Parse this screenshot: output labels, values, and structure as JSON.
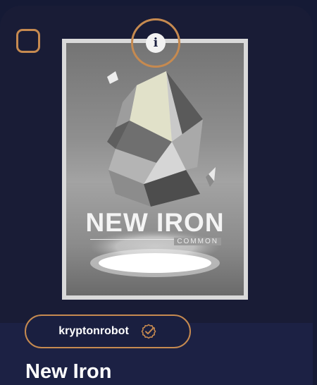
{
  "artwork": {
    "title": "NEW IRON",
    "rarity": "COMMON"
  },
  "creator": {
    "name": "kryptonrobot",
    "icon": "verified-check-icon"
  },
  "item": {
    "title": "New Iron"
  },
  "controls": {
    "select_icon": "checkbox",
    "info_icon": "info-icon"
  },
  "colors": {
    "accent": "#c68a50",
    "background": "#1a1f40",
    "text": "#ffffff"
  }
}
